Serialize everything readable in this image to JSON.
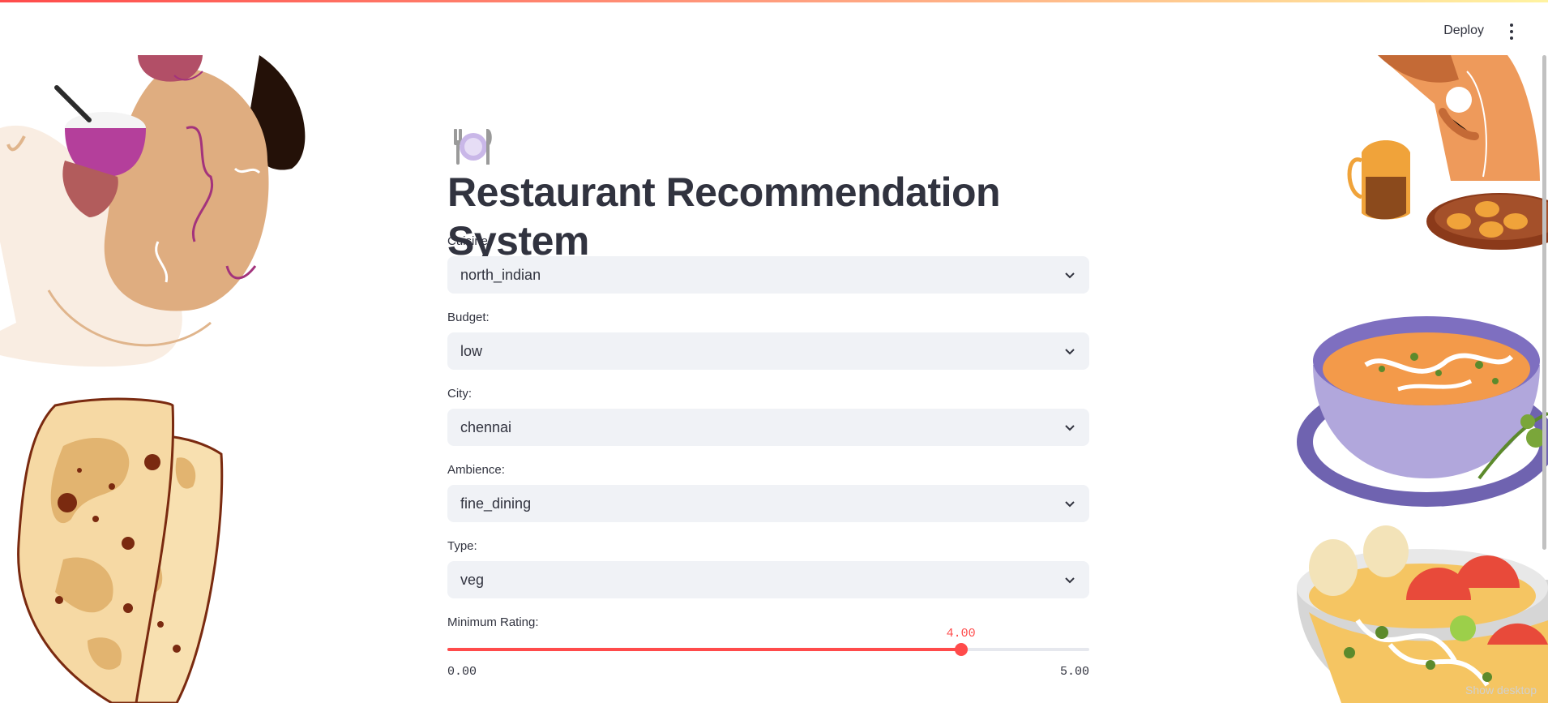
{
  "header": {
    "deploy_label": "Deploy",
    "menu_icon": "kebab-menu-icon"
  },
  "title": {
    "emoji": "plate-with-cutlery-icon",
    "text": "Restaurant Recommendation System"
  },
  "fields": [
    {
      "label": "Cuisine:",
      "value": "north_indian"
    },
    {
      "label": "Budget:",
      "value": "low"
    },
    {
      "label": "City:",
      "value": "chennai"
    },
    {
      "label": "Ambience:",
      "value": "fine_dining"
    },
    {
      "label": "Type:",
      "value": "veg"
    }
  ],
  "slider": {
    "label": "Minimum Rating:",
    "value": 4.0,
    "value_text": "4.00",
    "min_text": "0.00",
    "max_text": "5.00",
    "min": 0,
    "max": 5
  },
  "footer": {
    "overlay_text": "Show desktop"
  },
  "colors": {
    "accent": "#ff4b4b",
    "select_bg": "#f0f2f6",
    "text": "#31333f"
  }
}
